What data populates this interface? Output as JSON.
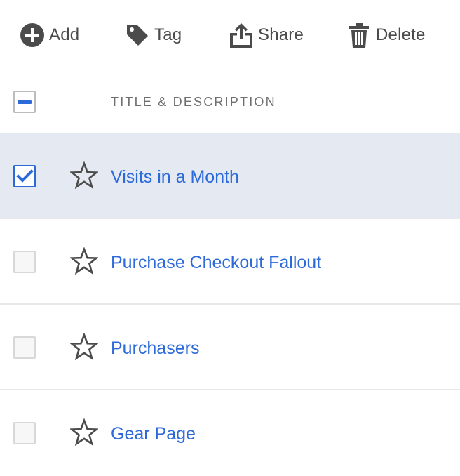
{
  "toolbar": {
    "add_label": "Add",
    "tag_label": "Tag",
    "share_label": "Share",
    "delete_label": "Delete"
  },
  "table": {
    "header": {
      "select_all_state": "indeterminate",
      "column_title": "TITLE & DESCRIPTION"
    },
    "rows": [
      {
        "title": "Visits in a Month",
        "selected": true,
        "favorite": false
      },
      {
        "title": "Purchase Checkout Fallout",
        "selected": false,
        "favorite": false
      },
      {
        "title": "Purchasers",
        "selected": false,
        "favorite": false
      },
      {
        "title": "Gear Page",
        "selected": false,
        "favorite": false
      }
    ]
  },
  "colors": {
    "accent": "#2d6ad9",
    "selected_row_bg": "#e5e9f1",
    "icon_gray": "#4b4b4b"
  },
  "icons": {
    "add": "add-circle-icon",
    "tag": "tag-icon",
    "share": "share-icon",
    "delete": "trash-icon",
    "favorite": "star-outline-icon"
  }
}
